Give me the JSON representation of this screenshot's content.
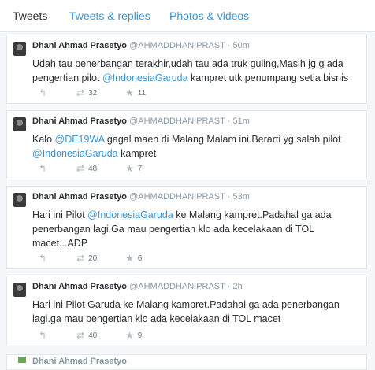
{
  "tabs": [
    "Tweets",
    "Tweets & replies",
    "Photos & videos"
  ],
  "tweets": [
    {
      "name": "Dhani Ahmad Prasetyo",
      "handle": "@AHMADDHANIPRAST",
      "time": "50m",
      "body": [
        {
          "text": "Udah tau penerbangan terakhir,udah tau ada truk guling,Masih jg g ada pengertian pilot "
        },
        {
          "text": "@IndonesiaGaruda",
          "mention": true
        },
        {
          "text": " kampret utk penumpang setia bisnis"
        }
      ],
      "retweets": "32",
      "favorites": "11"
    },
    {
      "name": "Dhani Ahmad Prasetyo",
      "handle": "@AHMADDHANIPRAST",
      "time": "51m",
      "body": [
        {
          "text": "Kalo "
        },
        {
          "text": "@DE19WA",
          "mention": true
        },
        {
          "text": " gagal maen di Malang Malam ini.Berarti yg salah pilot "
        },
        {
          "text": "@IndonesiaGaruda",
          "mention": true
        },
        {
          "text": " kampret"
        }
      ],
      "retweets": "48",
      "favorites": "7"
    },
    {
      "name": "Dhani Ahmad Prasetyo",
      "handle": "@AHMADDHANIPRAST",
      "time": "53m",
      "body": [
        {
          "text": "Hari ini Pilot "
        },
        {
          "text": "@IndonesiaGaruda",
          "mention": true
        },
        {
          "text": " ke Malang kampret.Padahal ga ada penerbangan lagi.Ga mau pengertian klo ada kecelakaan di TOL macet...ADP"
        }
      ],
      "retweets": "20",
      "favorites": "6"
    },
    {
      "name": "Dhani Ahmad Prasetyo",
      "handle": "@AHMADDHANIPRAST",
      "time": "2h",
      "body": [
        {
          "text": "Hari ini Pilot Garuda ke Malang kampret.Padahal ga ada penerbangan lagi.ga mau pengertian klo ada kecelakaan di TOL macet"
        }
      ],
      "retweets": "40",
      "favorites": "9"
    }
  ],
  "partial_tweet_name": "Dhani Ahmad Prasetyo",
  "icons": {
    "reply": "reply-icon",
    "retweet": "retweet-icon",
    "favorite": "star-icon"
  },
  "colors": {
    "link": "#3b94d9",
    "muted": "#8899a6",
    "border": "#e1e8ed"
  }
}
